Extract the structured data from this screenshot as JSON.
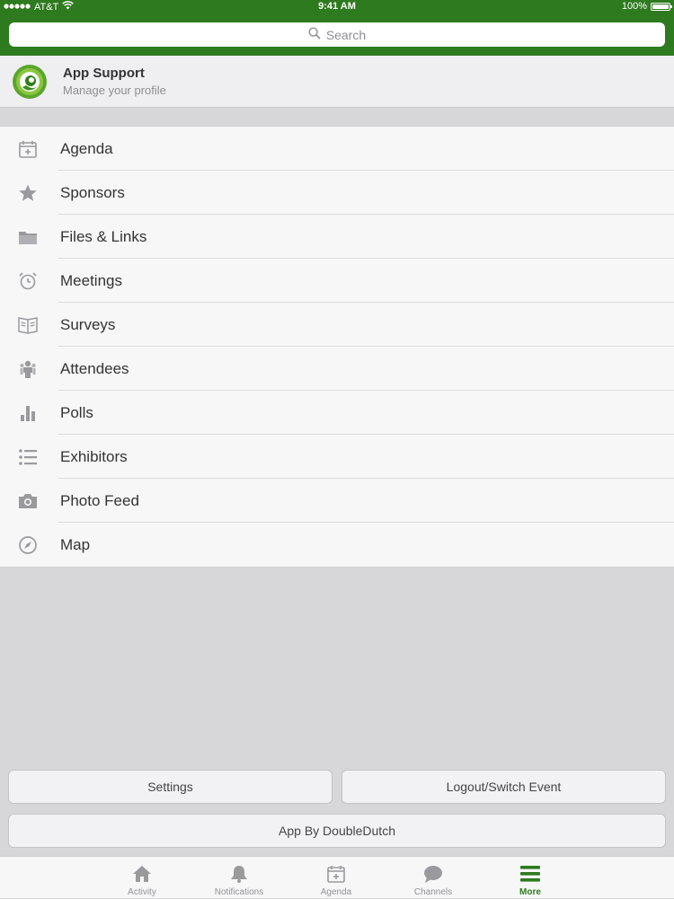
{
  "status_bar": {
    "carrier": "AT&T",
    "time": "9:41 AM",
    "battery": "100%"
  },
  "search": {
    "placeholder": "Search"
  },
  "profile": {
    "title": "App Support",
    "subtitle": "Manage your profile"
  },
  "menu": {
    "items": [
      {
        "label": "Agenda",
        "icon": "calendar-add-icon"
      },
      {
        "label": "Sponsors",
        "icon": "star-icon"
      },
      {
        "label": "Files & Links",
        "icon": "folder-icon"
      },
      {
        "label": "Meetings",
        "icon": "alarm-clock-icon"
      },
      {
        "label": "Surveys",
        "icon": "open-book-icon"
      },
      {
        "label": "Attendees",
        "icon": "people-icon"
      },
      {
        "label": "Polls",
        "icon": "bar-chart-icon"
      },
      {
        "label": "Exhibitors",
        "icon": "list-icon"
      },
      {
        "label": "Photo Feed",
        "icon": "camera-icon"
      },
      {
        "label": "Map",
        "icon": "compass-icon"
      }
    ]
  },
  "buttons": {
    "settings": "Settings",
    "logout": "Logout/Switch Event",
    "app_by": "App By DoubleDutch"
  },
  "tabbar": {
    "tabs": [
      {
        "label": "Activity",
        "icon": "home-icon"
      },
      {
        "label": "Notifications",
        "icon": "bell-icon"
      },
      {
        "label": "Agenda",
        "icon": "calendar-add-icon"
      },
      {
        "label": "Channels",
        "icon": "chat-bubble-icon"
      },
      {
        "label": "More",
        "icon": "menu-icon",
        "active": true
      }
    ]
  },
  "colors": {
    "brand_green": "#2e7a1f",
    "icon_gray": "#9a9a9e"
  }
}
